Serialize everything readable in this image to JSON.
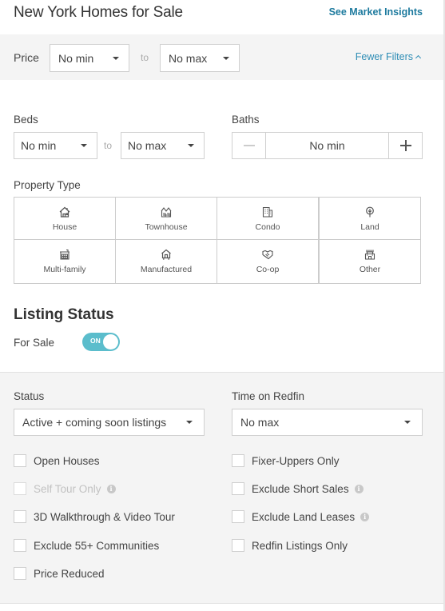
{
  "header": {
    "title": "New York Homes for Sale",
    "market_link": "See Market Insights"
  },
  "price": {
    "label": "Price",
    "min": "No min",
    "to": "to",
    "max": "No max",
    "fewer_filters": "Fewer Filters"
  },
  "beds": {
    "label": "Beds",
    "min": "No min",
    "to": "to",
    "max": "No max"
  },
  "baths": {
    "label": "Baths",
    "value": "No min"
  },
  "property_type": {
    "label": "Property Type",
    "items": [
      {
        "label": "House",
        "icon": "house-icon"
      },
      {
        "label": "Townhouse",
        "icon": "townhouse-icon"
      },
      {
        "label": "Condo",
        "icon": "condo-icon"
      },
      {
        "label": "Land",
        "icon": "land-tree-icon"
      },
      {
        "label": "Multi-family",
        "icon": "multi-family-icon"
      },
      {
        "label": "Manufactured",
        "icon": "manufactured-icon"
      },
      {
        "label": "Co-op",
        "icon": "co-op-handshake-icon"
      },
      {
        "label": "Other",
        "icon": "other-building-icon"
      }
    ]
  },
  "listing_status": {
    "title": "Listing Status",
    "for_sale_label": "For Sale",
    "toggle_text": "ON",
    "toggle_on": true
  },
  "status": {
    "label": "Status",
    "value": "Active + coming soon listings"
  },
  "time_on_redfin": {
    "label": "Time on Redfin",
    "value": "No max"
  },
  "checkboxes_left": [
    {
      "label": "Open Houses",
      "checked": false,
      "disabled": false,
      "info": false
    },
    {
      "label": "Self Tour Only",
      "checked": false,
      "disabled": true,
      "info": true
    },
    {
      "label": "3D Walkthrough & Video Tour",
      "checked": false,
      "disabled": false,
      "info": false
    },
    {
      "label": "Exclude 55+ Communities",
      "checked": false,
      "disabled": false,
      "info": false
    },
    {
      "label": "Price Reduced",
      "checked": false,
      "disabled": false,
      "info": false
    }
  ],
  "checkboxes_right": [
    {
      "label": "Fixer-Uppers Only",
      "checked": false,
      "disabled": false,
      "info": false
    },
    {
      "label": "Exclude Short Sales",
      "checked": false,
      "disabled": false,
      "info": true
    },
    {
      "label": "Exclude Land Leases",
      "checked": false,
      "disabled": false,
      "info": true
    },
    {
      "label": "Redfin Listings Only",
      "checked": false,
      "disabled": false,
      "info": false
    }
  ],
  "colors": {
    "link": "#1d7a9e",
    "toggle_on": "#5bbdcc",
    "section_gray": "#f4f4f4"
  }
}
